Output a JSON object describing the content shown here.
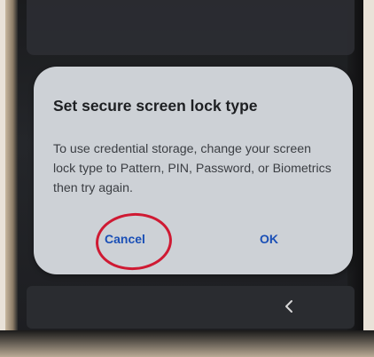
{
  "dialog": {
    "title": "Set secure screen lock type",
    "body": "To use credential storage, change your screen lock type to Pattern, PIN, Password, or Biometrics then try again.",
    "buttons": {
      "cancel": "Cancel",
      "ok": "OK"
    }
  },
  "navbar": {
    "back_icon": "chevron-left-icon"
  },
  "colors": {
    "dialog_bg": "#cdd1d6",
    "button_text": "#1a4fb6",
    "highlight_circle": "#cf1a33"
  }
}
